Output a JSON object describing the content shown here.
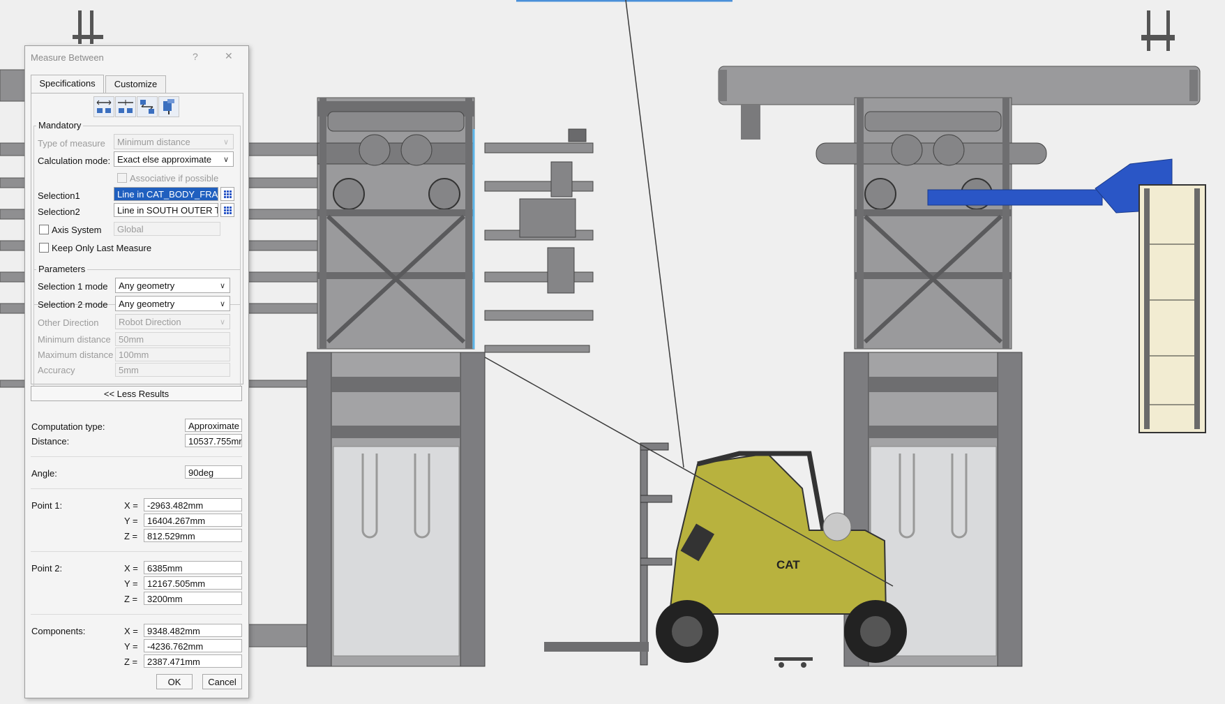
{
  "dialog": {
    "title": "Measure Between",
    "help_label": "?",
    "close_label": "✕",
    "tabs": [
      "Specifications",
      "Customize"
    ],
    "toolbar_icons": [
      "measure-between-icon",
      "measure-in-chain-icon",
      "measure-fan-icon",
      "measure-item-icon"
    ],
    "mandatory": {
      "heading": "Mandatory",
      "type_label": "Type of measure",
      "type_value": "Minimum distance",
      "calc_label": "Calculation mode:",
      "calc_value": "Exact else approximate",
      "associative_label": "Associative if possible",
      "selection1_label": "Selection1",
      "selection1_value": "Line in CAT_BODY_FRAME",
      "selection2_label": "Selection2",
      "selection2_value": "Line in SOUTH OUTER TRA",
      "axis_label": "Axis System",
      "axis_value": "Global",
      "keep_label": "Keep Only Last Measure"
    },
    "parameters": {
      "heading": "Parameters",
      "sel1_mode_label": "Selection 1 mode",
      "sel1_mode_value": "Any geometry",
      "sel2_mode_label": "Selection 2 mode",
      "sel2_mode_value": "Any geometry",
      "other_dir_label": "Other Direction",
      "other_dir_value": "Robot Direction",
      "min_label": "Minimum distance",
      "min_value": "50mm",
      "max_label": "Maximum distance",
      "max_value": "100mm",
      "acc_label": "Accuracy",
      "acc_value": "5mm"
    },
    "less_results": "<< Less Results",
    "results": {
      "comp_type_label": "Computation type:",
      "comp_type_value": "Approximate",
      "distance_label": "Distance:",
      "distance_value": "10537.755mr",
      "angle_label": "Angle:",
      "angle_value": "90deg",
      "point1_label": "Point 1:",
      "point1": {
        "x": "-2963.482mm",
        "y": "16404.267mm",
        "z": "812.529mm"
      },
      "point2_label": "Point 2:",
      "point2": {
        "x": "6385mm",
        "y": "12167.505mm",
        "z": "3200mm"
      },
      "components_label": "Components:",
      "components": {
        "x": "9348.482mm",
        "y": "-4236.762mm",
        "z": "2387.471mm"
      },
      "x_label": "X =",
      "y_label": "Y =",
      "z_label": "Z ="
    },
    "ok_label": "OK",
    "cancel_label": "Cancel"
  },
  "scene": {
    "forklift_badge": "CAT",
    "colors": {
      "background": "#efefef",
      "frame": "#7d7d80",
      "selection_blue": "#2a56c6",
      "forklift": "#b8b23e",
      "measure_line": "#3a3a3a"
    }
  }
}
